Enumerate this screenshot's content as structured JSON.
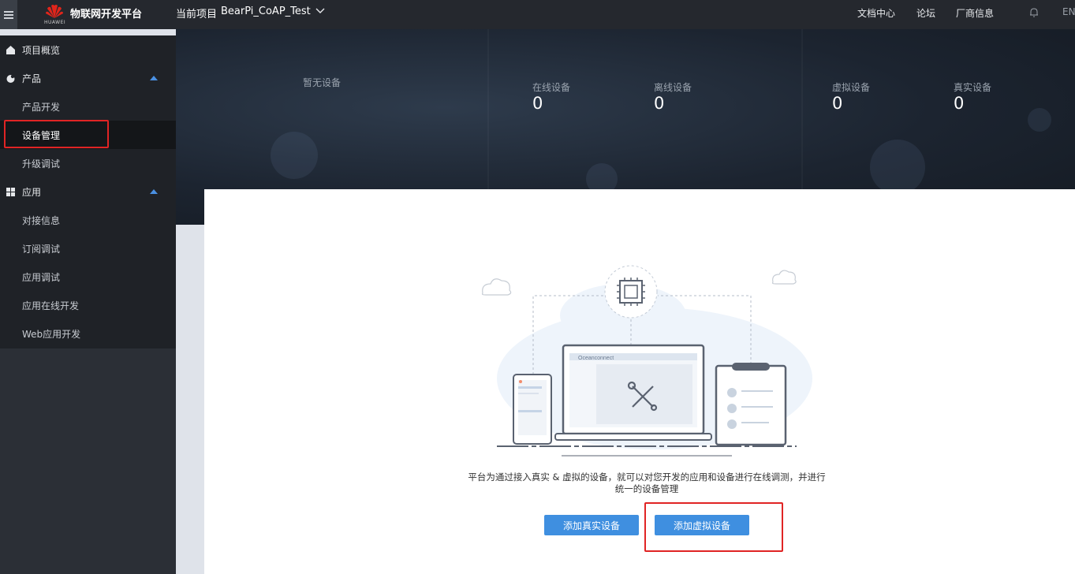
{
  "header": {
    "menu_icon": "hamburger-icon",
    "brand_small": "HUAWEI",
    "platform_name": "物联网开发平台",
    "project_label": "当前项目",
    "project_name": "BearPi_CoAP_Test",
    "links": [
      "文档中心",
      "论坛",
      "厂商信息"
    ],
    "bell_icon": "bell-icon",
    "lang": "EN"
  },
  "sidebar": {
    "items": [
      {
        "label": "项目概览",
        "icon": "home-icon",
        "type": "group"
      },
      {
        "label": "产品",
        "icon": "product-icon",
        "type": "group",
        "expanded": true
      },
      {
        "label": "产品开发",
        "type": "sub"
      },
      {
        "label": "设备管理",
        "type": "sub",
        "active": true
      },
      {
        "label": "升级调试",
        "type": "sub"
      },
      {
        "label": "应用",
        "icon": "apps-icon",
        "type": "group",
        "expanded": true
      },
      {
        "label": "对接信息",
        "type": "sub"
      },
      {
        "label": "订阅调试",
        "type": "sub"
      },
      {
        "label": "应用调试",
        "type": "sub"
      },
      {
        "label": "应用在线开发",
        "type": "sub"
      },
      {
        "label": "Web应用开发",
        "type": "sub"
      }
    ]
  },
  "stats": {
    "empty_label": "暂无设备",
    "online": {
      "label": "在线设备",
      "value": "0"
    },
    "offline": {
      "label": "离线设备",
      "value": "0"
    },
    "virtual": {
      "label": "虚拟设备",
      "value": "0"
    },
    "real": {
      "label": "真实设备",
      "value": "0"
    }
  },
  "main": {
    "illustration_brand": "Oceanconnect",
    "description": "平台为通过接入真实 & 虚拟的设备，就可以对您开发的应用和设备进行在线调测，并进行统一的设备管理",
    "add_real_label": "添加真实设备",
    "add_virtual_label": "添加虚拟设备"
  },
  "colors": {
    "topbar": "#25282e",
    "sidebar": "#1f2227",
    "accent": "#3f8fe0",
    "highlight": "#e02424"
  }
}
